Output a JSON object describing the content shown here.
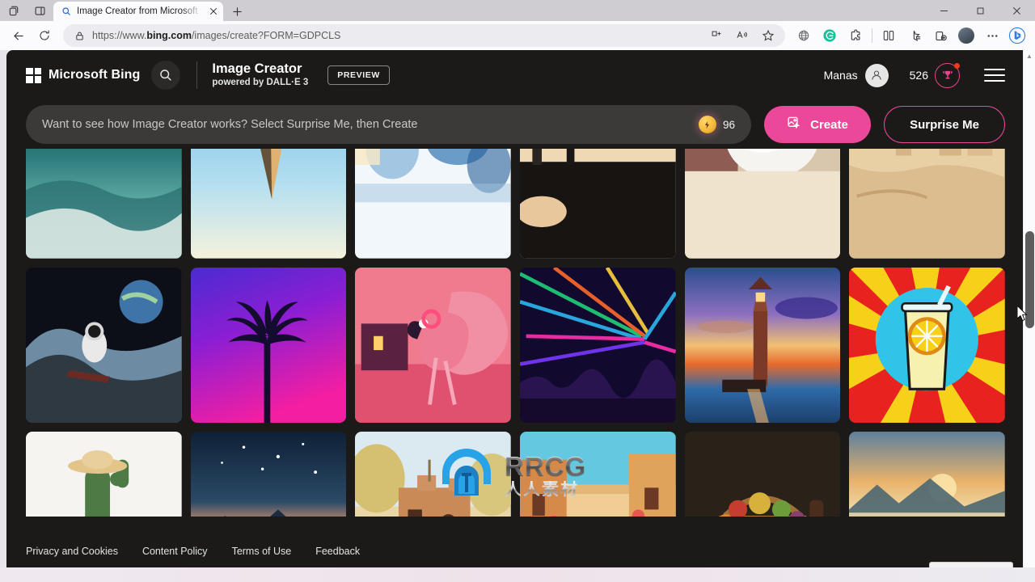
{
  "browser": {
    "tab": {
      "title": "Image Creator from Microsoft Bi",
      "favicon": "search-icon"
    },
    "url_scheme": "https://www.",
    "url_host": "bing.com",
    "url_path": "/images/create?FORM=GDPCLS",
    "toolbar_icons": [
      "back-icon",
      "refresh-icon",
      "lock-icon",
      "split-screen-icon",
      "read-aloud-icon",
      "favorite-star-icon",
      "globe-icon",
      "grammarly-icon",
      "extensions-icon",
      "split-view-icon",
      "collections-icon",
      "browser-essentials-icon",
      "profile-avatar-icon",
      "more-options-icon",
      "bing-chat-icon"
    ],
    "window_controls": [
      "minimize",
      "maximize",
      "close"
    ]
  },
  "header": {
    "brand": "Microsoft Bing",
    "search_icon": "search-icon",
    "title": "Image Creator",
    "subtitle": "powered by DALL·E 3",
    "preview_badge": "PREVIEW",
    "account_name": "Manas",
    "rewards_count": "526",
    "rewards_icon": "rewards-trophy-icon",
    "menu_icon": "hamburger-menu-icon"
  },
  "prompt": {
    "placeholder": "Want to see how Image Creator works? Select Surprise Me, then Create",
    "value": "",
    "boost_count": "96",
    "boost_icon": "boost-coin-icon",
    "create_label": "Create",
    "create_icon": "image-create-icon",
    "surprise_label": "Surprise Me"
  },
  "gallery": {
    "items": [
      {
        "name": "ocean-waves-boat",
        "alt": "Teal ocean waves with distant boat"
      },
      {
        "name": "ice-cream-cone",
        "alt": "Ice cream cone against pale blue sky"
      },
      {
        "name": "abstract-watercolor-blue",
        "alt": "Blue abstract watercolor wash"
      },
      {
        "name": "silhouette-legs-beach",
        "alt": "Silhouetted legs on warm sand"
      },
      {
        "name": "white-sphere-closeup",
        "alt": "Soft white sphere close-up"
      },
      {
        "name": "sandcastle-desert",
        "alt": "Sandcastle towers in golden sand"
      },
      {
        "name": "astronaut-surfing",
        "alt": "Astronaut surfing a wave with Earth behind"
      },
      {
        "name": "palm-tree-synthwave",
        "alt": "Palm tree silhouette on magenta purple gradient"
      },
      {
        "name": "flamingo-headphones",
        "alt": "Pink flamingo wearing headphones dancing"
      },
      {
        "name": "concert-lasers",
        "alt": "Concert crowd with laser light show"
      },
      {
        "name": "lighthouse-sunset",
        "alt": "Lighthouse at sunset with colorful sky"
      },
      {
        "name": "lemonade-popart",
        "alt": "Pop art lemonade glass on red yellow rays"
      },
      {
        "name": "cactus-guitar-hat",
        "alt": "Cactus with straw hat playing guitar"
      },
      {
        "name": "mountain-night-tent",
        "alt": "Tent glowing under starry mountain dusk"
      },
      {
        "name": "adobe-desert-house",
        "alt": "Adobe desert house with cacti"
      },
      {
        "name": "mediterranean-street",
        "alt": "Sunlit mediterranean street with flowers"
      },
      {
        "name": "picnic-basket",
        "alt": "Picnic basket with fruit and wine"
      },
      {
        "name": "sunset-lake-mountains",
        "alt": "Warm sunset over lake and mountains"
      }
    ]
  },
  "footer": {
    "links": [
      "Privacy and Cookies",
      "Content Policy",
      "Terms of Use",
      "Feedback"
    ],
    "feedback_button": "Feedback",
    "feedback_icon": "speech-bubble-icon"
  },
  "watermark": {
    "brand": "RRCG",
    "subtitle": "人人素材",
    "logo": "rrcg-shield-icon"
  },
  "colors": {
    "accent_pink": "#ec4899",
    "rewards_pink": "#e3468d",
    "page_background": "#1b1a19",
    "chrome_background": "#fbfbfd",
    "feedback_blue": "#2b5797"
  }
}
